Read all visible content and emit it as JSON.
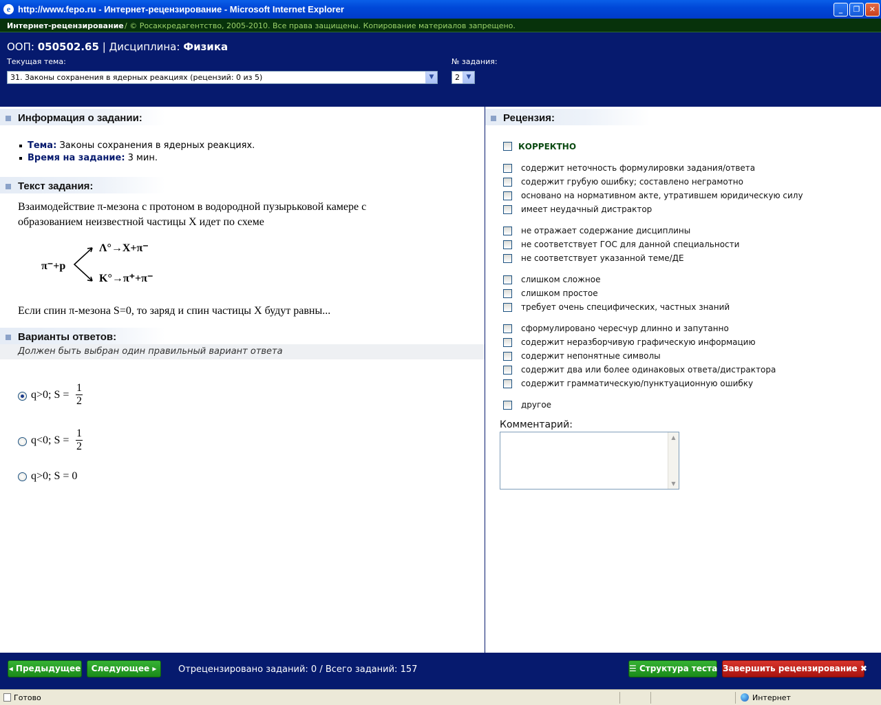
{
  "window": {
    "title": "http://www.fepo.ru - Интернет-рецензирование - Microsoft Internet Explorer"
  },
  "sitebar": {
    "name": "Интернет-рецензирование",
    "copyright": "/ © Росаккредагентство, 2005-2010. Все права защищены. Копирование материалов запрещено."
  },
  "header": {
    "oop_label": "ООП:",
    "oop_value": "050502.65",
    "discipline_label": "| Дисциплина:",
    "discipline_value": "Физика",
    "topic_label": "Текущая тема:",
    "topic_selected": "31. Законы сохранения в ядерных реакциях  (рецензий: 0 из 5)",
    "task_no_label": "№ задания:",
    "task_no_selected": "2"
  },
  "info": {
    "heading": "Информация о задании:",
    "topic_key": "Тема:",
    "topic_value": "Законы сохранения в ядерных реакциях.",
    "time_key": "Время на задание:",
    "time_value": "3 мин."
  },
  "task": {
    "heading": "Текст задания:",
    "text": "Взаимодействие π-мезона с протоном в водородной пузырьковой камере с образованием неизвестной частицы X идет по схеме",
    "scheme_left": "π⁻+p",
    "scheme_top": "Λ°→X+π⁻",
    "scheme_bottom": "K°→π⁺+π⁻",
    "question": "Если спин π-мезона S=0, то заряд и спин частицы X будут равны..."
  },
  "answers": {
    "heading": "Варианты ответов:",
    "hint": "Должен быть выбран один правильный вариант ответа",
    "options": [
      {
        "charge": "q>0;",
        "spin_prefix": "S =",
        "num": "1",
        "den": "2",
        "selected": true
      },
      {
        "charge": "q<0;",
        "spin_prefix": "S =",
        "num": "1",
        "den": "2",
        "selected": false
      },
      {
        "charge": "q>0;",
        "spin_prefix": "S = 0",
        "selected": false
      }
    ]
  },
  "review": {
    "heading": "Рецензия:",
    "correct": "КОРРЕКТНО",
    "criteria": [
      "содержит неточность формулировки задания/ответа",
      "содержит грубую ошибку; составлено неграмотно",
      "основано на нормативном акте, утратившем юридическую силу",
      "имеет неудачный дистрактор",
      "не отражает содержание дисциплины",
      "не соответствует ГОС для данной специальности",
      "не соответствует указанной теме/ДЕ",
      "слишком сложное",
      "слишком простое",
      "требует очень специфических, частных знаний",
      "сформулировано чересчур длинно и запутанно",
      "содержит неразборчивую графическую информацию",
      "содержит непонятные символы",
      "содержит два или более одинаковых ответа/дистрактора",
      "содержит грамматическую/пунктуационную ошибку",
      "другое"
    ],
    "comment_label": "Комментарий:"
  },
  "footer": {
    "prev": "Предыдущее",
    "next": "Следующее",
    "stats": "Отрецензировано заданий: 0 / Всего заданий: 157",
    "structure": "Структура теста",
    "finish": "Завершить рецензирование"
  },
  "status": {
    "ready": "Готово",
    "zone": "Интернет"
  }
}
